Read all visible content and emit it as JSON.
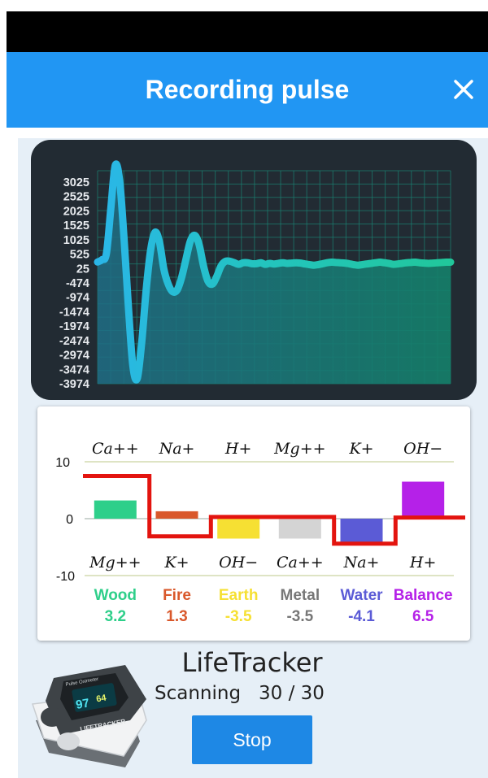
{
  "header": {
    "title": "Recording pulse",
    "close_icon": "close-icon"
  },
  "pulse_chart": {
    "y_ticks": [
      "3025",
      "2525",
      "2025",
      "1525",
      "1025",
      "525",
      "25",
      "-474",
      "-974",
      "-1474",
      "-1974",
      "-2474",
      "-2974",
      "-3474",
      "-3974"
    ],
    "colors": {
      "background": "#222b33",
      "grid": "#1d8a78",
      "line_start": "#2ab6e8",
      "line_end": "#21c79b"
    }
  },
  "chart_data": [
    {
      "type": "line",
      "title": "",
      "ylim": [
        -3974,
        3025
      ],
      "y_ticks": [
        3025,
        2525,
        2025,
        1525,
        1025,
        525,
        25,
        -474,
        -974,
        -1474,
        -1974,
        -2474,
        -2974,
        -3474,
        -3974
      ],
      "x": [
        0,
        1,
        2,
        3,
        4,
        5,
        6,
        7,
        8,
        9,
        10,
        11,
        12,
        13,
        14,
        15,
        16,
        17,
        18,
        19,
        20,
        21,
        22,
        23,
        24,
        25,
        26,
        27,
        28,
        29,
        30,
        31,
        32,
        33,
        34,
        35,
        36,
        37,
        38,
        39,
        40,
        41,
        42,
        43,
        44,
        45,
        46,
        47,
        48,
        49,
        50,
        51,
        52,
        53,
        54,
        55,
        56,
        57,
        58,
        59,
        60,
        61,
        62,
        63,
        64,
        65,
        66,
        67,
        68,
        69,
        70,
        71,
        72,
        73,
        74,
        75,
        76,
        77,
        78,
        79,
        80
      ],
      "values": [
        25,
        100,
        300,
        1800,
        3200,
        2700,
        800,
        -1500,
        -3400,
        -3800,
        -2600,
        -900,
        400,
        1000,
        700,
        -200,
        -700,
        -950,
        -900,
        -500,
        100,
        700,
        900,
        600,
        -100,
        -600,
        -700,
        -450,
        -100,
        50,
        50,
        0,
        -50,
        0,
        0,
        -30,
        -30,
        0,
        -50,
        -20,
        -40,
        -20,
        0,
        -20,
        -10,
        0,
        -10,
        -40,
        -60,
        -80,
        -60,
        -30,
        0,
        20,
        10,
        0,
        -10,
        -30,
        -60,
        -80,
        -60,
        -40,
        -20,
        0,
        20,
        0,
        -20,
        -50,
        -40,
        -20,
        0,
        10,
        20,
        0,
        -10,
        -20,
        -10,
        0,
        10,
        20,
        20
      ]
    },
    {
      "type": "bar",
      "ylim": [
        -10,
        10
      ],
      "y_ticks": [
        10,
        0,
        -10
      ],
      "categories": [
        "Wood",
        "Fire",
        "Earth",
        "Metal",
        "Water",
        "Balance"
      ],
      "values": [
        3.2,
        1.3,
        -3.5,
        -3.5,
        -4.1,
        6.5
      ],
      "value_labels": [
        "3.2",
        "1.3",
        "-3.5",
        "-3.5",
        "-4.1",
        "6.5"
      ],
      "colors": [
        "#2ecf8a",
        "#d9582b",
        "#f6e033",
        "#d4d4d4",
        "#5b5bd6",
        "#b521e8"
      ],
      "top_ions": [
        "Ca++",
        "Na+",
        "H+",
        "Mg++",
        "K+",
        "OH−"
      ],
      "bottom_ions": [
        "Mg++",
        "K+",
        "OH−",
        "Ca++",
        "Na+",
        "H+"
      ],
      "balance_step_line": [
        7.5,
        -3.1,
        0.3,
        0.3,
        -4.4,
        0.2
      ],
      "balance_line_color": "#e3140f"
    }
  ],
  "app": {
    "name": "LifeTracker",
    "status_label": "Scanning",
    "progress_text": "30 / 30",
    "progress_current": 30,
    "progress_total": 30
  },
  "device": {
    "icon": "pulse-oximeter-device",
    "screen_left": "97",
    "screen_right": "64",
    "brand": "LIFETRACKER",
    "screen_title": "Pulse Oximeter"
  },
  "stop_button": {
    "label": "Stop"
  }
}
